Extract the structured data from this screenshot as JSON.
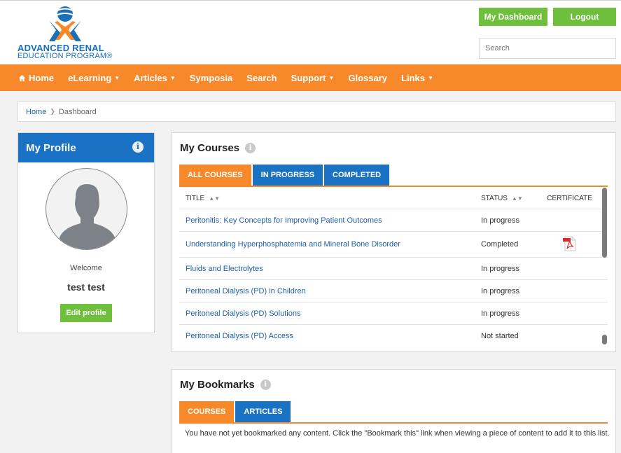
{
  "header": {
    "logo_line1": "ADVANCED RENAL",
    "logo_line2": "EDUCATION PROGRAM®",
    "dashboard_label": "My Dashboard",
    "logout_label": "Logout",
    "search_placeholder": "Search"
  },
  "nav": {
    "items": [
      {
        "label": "Home",
        "caret": ""
      },
      {
        "label": "eLearning",
        "caret": "▼"
      },
      {
        "label": "Articles",
        "caret": "▼"
      },
      {
        "label": "Symposia",
        "caret": ""
      },
      {
        "label": "Search",
        "caret": ""
      },
      {
        "label": "Support",
        "caret": "▼"
      },
      {
        "label": "Glossary",
        "caret": ""
      },
      {
        "label": "Links",
        "caret": "▼"
      }
    ]
  },
  "breadcrumb": {
    "home": "Home",
    "current": "Dashboard"
  },
  "profile": {
    "title": "My Profile",
    "welcome": "Welcome",
    "user_name": "test test",
    "edit_label": "Edit profile"
  },
  "courses": {
    "title": "My Courses",
    "tabs": [
      "ALL COURSES",
      "IN PROGRESS",
      "COMPLETED"
    ],
    "columns": {
      "title": "TITLE",
      "status": "STATUS",
      "certificate": "CERTIFICATE"
    },
    "rows": [
      {
        "title": "Peritonitis: Key Concepts for Improving Patient Outcomes",
        "status": "In progress",
        "certificate": false
      },
      {
        "title": "Understanding Hyperphosphatemia and Mineral Bone Disorder",
        "status": "Completed",
        "certificate": true
      },
      {
        "title": "Fluids and Electrolytes",
        "status": "In progress",
        "certificate": false
      },
      {
        "title": "Peritoneal Dialysis (PD) in Children",
        "status": "In progress",
        "certificate": false
      },
      {
        "title": "Peritoneal Dialysis (PD) Solutions",
        "status": "In progress",
        "certificate": false
      },
      {
        "title": "Peritoneal Dialysis (PD) Access",
        "status": "Not started",
        "certificate": false
      }
    ]
  },
  "bookmarks": {
    "title": "My Bookmarks",
    "tabs": [
      "COURSES",
      "ARTICLES"
    ],
    "empty_message": "You have not yet bookmarked any content. Click the \"Bookmark this\" link when viewing a piece of content to add it to this list."
  },
  "colors": {
    "orange": "#f7892b",
    "blue": "#1972c3",
    "green": "#6dbf3c",
    "link": "#1f5fa8"
  }
}
